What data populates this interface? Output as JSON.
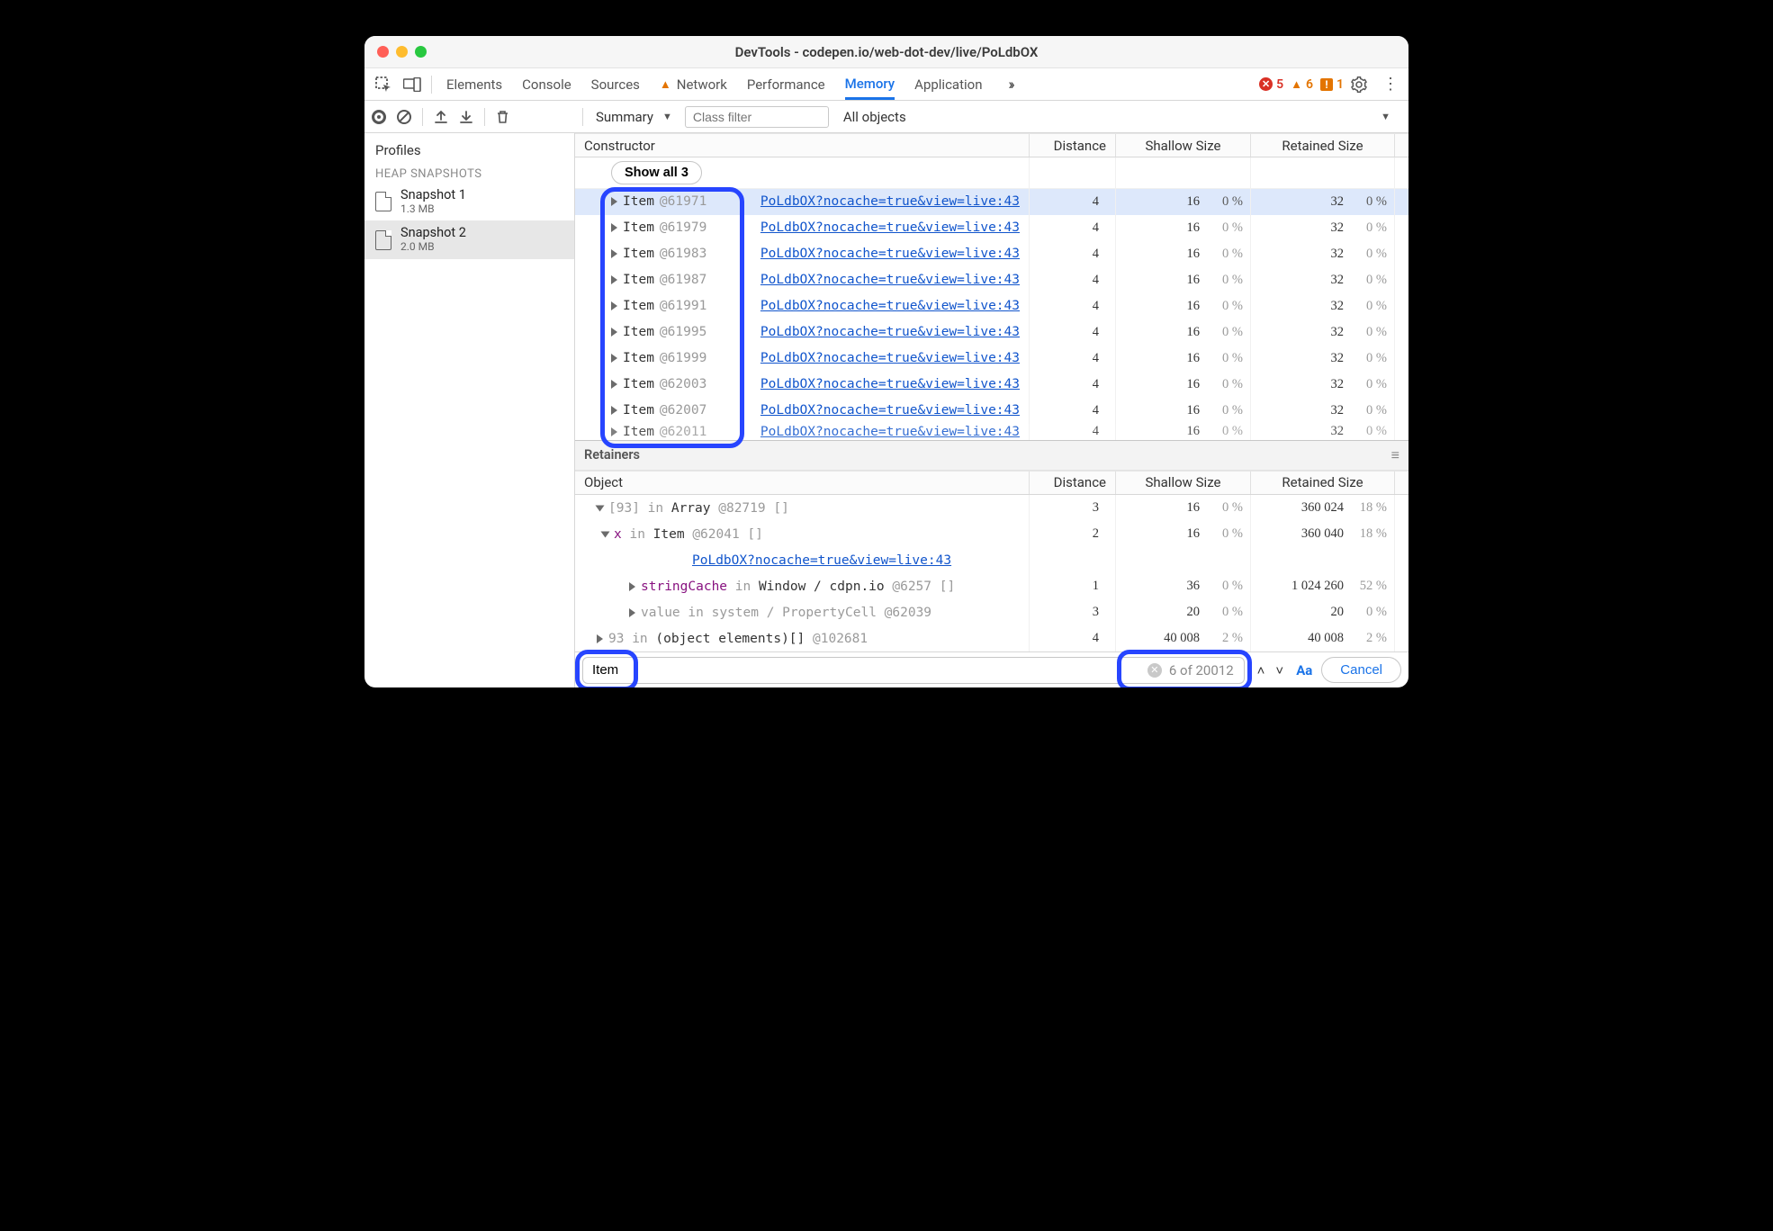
{
  "title": "DevTools - codepen.io/web-dot-dev/live/PoLdbOX",
  "tabs": [
    "Elements",
    "Console",
    "Sources",
    "Network",
    "Performance",
    "Memory",
    "Application"
  ],
  "tabs_active_index": 5,
  "tabs_warn_index": 3,
  "badges": {
    "errors": 5,
    "warnings": 6,
    "issues": 1
  },
  "action_bar": {
    "summary_label": "Summary",
    "class_filter_placeholder": "Class filter",
    "all_objects_label": "All objects"
  },
  "sidebar": {
    "profiles_label": "Profiles",
    "section_label": "HEAP SNAPSHOTS",
    "snapshots": [
      {
        "name": "Snapshot 1",
        "size": "1.3 MB"
      },
      {
        "name": "Snapshot 2",
        "size": "2.0 MB"
      }
    ],
    "selected_index": 1
  },
  "constructor_header": {
    "main": "Constructor",
    "distance": "Distance",
    "shallow": "Shallow Size",
    "retained": "Retained Size"
  },
  "show_all_label": "Show all 3",
  "rows": [
    {
      "name": "Item",
      "id": "@61971",
      "src": "PoLdbOX?nocache=true&view=live:43",
      "dist": 4,
      "shallow": 16,
      "shallow_pct": "0 %",
      "retained": 32,
      "retained_pct": "0 %",
      "selected": true
    },
    {
      "name": "Item",
      "id": "@61979",
      "src": "PoLdbOX?nocache=true&view=live:43",
      "dist": 4,
      "shallow": 16,
      "shallow_pct": "0 %",
      "retained": 32,
      "retained_pct": "0 %"
    },
    {
      "name": "Item",
      "id": "@61983",
      "src": "PoLdbOX?nocache=true&view=live:43",
      "dist": 4,
      "shallow": 16,
      "shallow_pct": "0 %",
      "retained": 32,
      "retained_pct": "0 %"
    },
    {
      "name": "Item",
      "id": "@61987",
      "src": "PoLdbOX?nocache=true&view=live:43",
      "dist": 4,
      "shallow": 16,
      "shallow_pct": "0 %",
      "retained": 32,
      "retained_pct": "0 %"
    },
    {
      "name": "Item",
      "id": "@61991",
      "src": "PoLdbOX?nocache=true&view=live:43",
      "dist": 4,
      "shallow": 16,
      "shallow_pct": "0 %",
      "retained": 32,
      "retained_pct": "0 %"
    },
    {
      "name": "Item",
      "id": "@61995",
      "src": "PoLdbOX?nocache=true&view=live:43",
      "dist": 4,
      "shallow": 16,
      "shallow_pct": "0 %",
      "retained": 32,
      "retained_pct": "0 %"
    },
    {
      "name": "Item",
      "id": "@61999",
      "src": "PoLdbOX?nocache=true&view=live:43",
      "dist": 4,
      "shallow": 16,
      "shallow_pct": "0 %",
      "retained": 32,
      "retained_pct": "0 %"
    },
    {
      "name": "Item",
      "id": "@62003",
      "src": "PoLdbOX?nocache=true&view=live:43",
      "dist": 4,
      "shallow": 16,
      "shallow_pct": "0 %",
      "retained": 32,
      "retained_pct": "0 %"
    },
    {
      "name": "Item",
      "id": "@62007",
      "src": "PoLdbOX?nocache=true&view=live:43",
      "dist": 4,
      "shallow": 16,
      "shallow_pct": "0 %",
      "retained": 32,
      "retained_pct": "0 %"
    },
    {
      "name": "Item",
      "id": "@62011",
      "src": "PoLdbOX?nocache=true&view=live:43",
      "dist": 4,
      "shallow": 16,
      "shallow_pct": "0 %",
      "retained": 32,
      "retained_pct": "0 %",
      "partial": true
    }
  ],
  "retainers": {
    "title": "Retainers",
    "header": {
      "main": "Object",
      "distance": "Distance",
      "shallow": "Shallow Size",
      "retained": "Retained Size"
    },
    "rows": [
      {
        "indent": 1,
        "open": true,
        "text_parts": [
          {
            "t": "[93]",
            "cls": "idx"
          },
          {
            "t": " in ",
            "cls": "kw"
          },
          {
            "t": "Array ",
            "cls": "in"
          },
          {
            "t": "@82719 []",
            "cls": "obj-id"
          }
        ],
        "dist": 3,
        "shallow": "16",
        "shallow_pct": "0 %",
        "retained": "360 024",
        "retained_pct": "18 %"
      },
      {
        "indent": 2,
        "open": true,
        "text_parts": [
          {
            "t": "x",
            "cls": "prop"
          },
          {
            "t": " in ",
            "cls": "kw"
          },
          {
            "t": "Item ",
            "cls": "in"
          },
          {
            "t": "@62041 []",
            "cls": "obj-id"
          }
        ],
        "dist": 2,
        "shallow": "16",
        "shallow_pct": "0 %",
        "retained": "360 040",
        "retained_pct": "18 %"
      },
      {
        "indent": 3,
        "linkonly": true,
        "link": "PoLdbOX?nocache=true&view=live:43"
      },
      {
        "indent": 3,
        "open": false,
        "text_parts": [
          {
            "t": "stringCache",
            "cls": "prop"
          },
          {
            "t": " in ",
            "cls": "kw"
          },
          {
            "t": "Window / cdpn.io ",
            "cls": "in"
          },
          {
            "t": "@6257 []",
            "cls": "obj-id"
          }
        ],
        "dist": 1,
        "shallow": "36",
        "shallow_pct": "0 %",
        "retained": "1 024 260",
        "retained_pct": "52 %"
      },
      {
        "indent": 3,
        "open": false,
        "text_parts": [
          {
            "t": "value ",
            "cls": "sys"
          },
          {
            "t": "in ",
            "cls": "sys"
          },
          {
            "t": "system / PropertyCell ",
            "cls": "sys"
          },
          {
            "t": "@62039",
            "cls": "sys"
          }
        ],
        "dist": 3,
        "shallow": "20",
        "shallow_pct": "0 %",
        "retained": "20",
        "retained_pct": "0 %"
      },
      {
        "indent": 1,
        "open": false,
        "text_parts": [
          {
            "t": "93 ",
            "cls": "idx"
          },
          {
            "t": "in ",
            "cls": "kw"
          },
          {
            "t": "(object elements)[] ",
            "cls": "in"
          },
          {
            "t": "@102681",
            "cls": "obj-id"
          }
        ],
        "dist": 4,
        "shallow": "40 008",
        "shallow_pct": "2 %",
        "retained": "40 008",
        "retained_pct": "2 %"
      }
    ]
  },
  "search": {
    "value": "Item",
    "count_label": "6 of 20012",
    "aa_label": "Aa",
    "cancel_label": "Cancel"
  }
}
